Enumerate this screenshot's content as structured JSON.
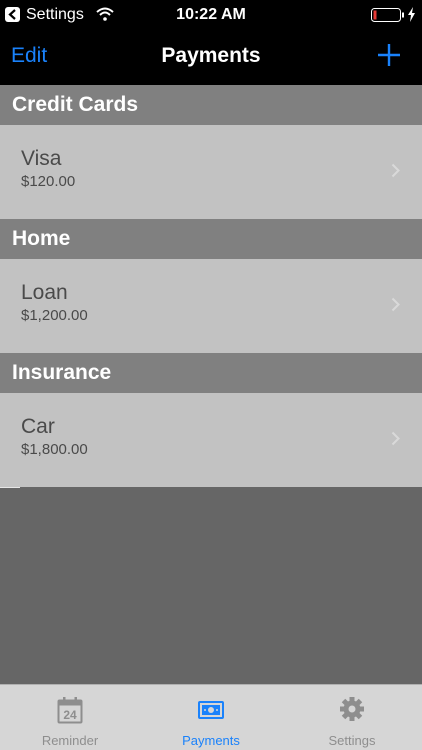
{
  "status_bar": {
    "back_label": "Settings",
    "time": "10:22 AM"
  },
  "nav": {
    "edit_label": "Edit",
    "title": "Payments"
  },
  "sections": [
    {
      "title": "Credit Cards",
      "rows": [
        {
          "name": "Visa",
          "amount": "$120.00"
        }
      ]
    },
    {
      "title": "Home",
      "rows": [
        {
          "name": "Loan",
          "amount": "$1,200.00"
        }
      ]
    },
    {
      "title": "Insurance",
      "rows": [
        {
          "name": "Car",
          "amount": "$1,800.00"
        }
      ]
    }
  ],
  "tabs": [
    {
      "label": "Reminder",
      "icon": "calendar-icon",
      "calendar_day": "24",
      "active": false
    },
    {
      "label": "Payments",
      "icon": "banknote-icon",
      "active": true
    },
    {
      "label": "Settings",
      "icon": "gear-icon",
      "active": false
    }
  ],
  "colors": {
    "accent": "#1a82fb",
    "section_header": "#808080",
    "row_background": "#c2c2c2",
    "empty_background": "#666666",
    "battery_low": "#e53935"
  }
}
